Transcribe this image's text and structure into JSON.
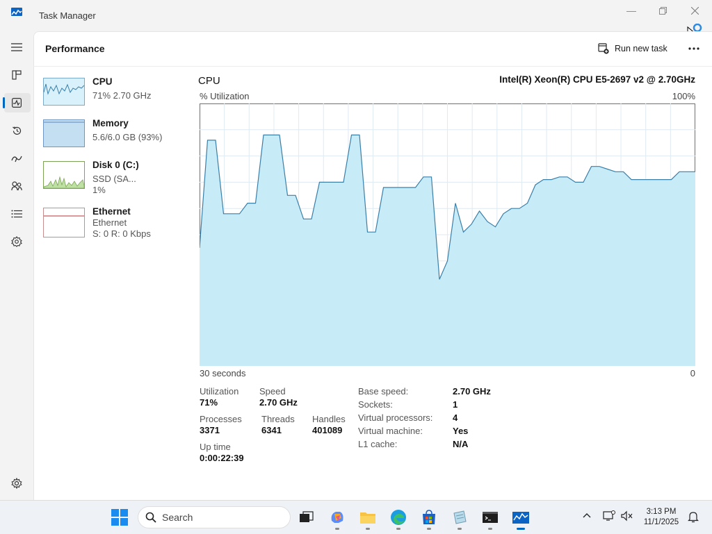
{
  "window": {
    "title": "Task Manager"
  },
  "header": {
    "page_title": "Performance",
    "run_new_task": "Run new task"
  },
  "devices": [
    {
      "name": "CPU",
      "detail1": "71%  2.70 GHz",
      "detail2": ""
    },
    {
      "name": "Memory",
      "detail1": "5.6/6.0 GB (93%)",
      "detail2": ""
    },
    {
      "name": "Disk 0 (C:)",
      "detail1": "SSD (SA...",
      "detail2": "1%"
    },
    {
      "name": "Ethernet",
      "detail1": "Ethernet",
      "detail2": "S: 0  R: 0 Kbps"
    }
  ],
  "graph": {
    "title": "CPU",
    "model": "Intel(R) Xeon(R) CPU E5-2697 v2 @ 2.70GHz",
    "util_label": "% Utilization",
    "max_label": "100%",
    "time_label": "30 seconds",
    "min_label": "0",
    "fill_color": "#c8ebf8",
    "line_color": "#3a7fa8"
  },
  "chart_data": {
    "type": "area",
    "xlabel": "30 seconds",
    "ylabel": "% Utilization",
    "ylim": [
      0,
      100
    ],
    "values": [
      45,
      86,
      86,
      58,
      58,
      58,
      62,
      62,
      88,
      88,
      88,
      65,
      65,
      56,
      56,
      70,
      70,
      70,
      70,
      88,
      88,
      51,
      51,
      68,
      68,
      68,
      68,
      68,
      72,
      72,
      33,
      40,
      62,
      51,
      54,
      59,
      55,
      53,
      58,
      60,
      60,
      62,
      69,
      71,
      71,
      72,
      72,
      70,
      70,
      76,
      76,
      75,
      74,
      74,
      71,
      71,
      71,
      71,
      71,
      71,
      74,
      74,
      74
    ]
  },
  "stats": {
    "utilization": {
      "label": "Utilization",
      "value": "71%"
    },
    "speed": {
      "label": "Speed",
      "value": "2.70 GHz"
    },
    "processes": {
      "label": "Processes",
      "value": "3371"
    },
    "threads": {
      "label": "Threads",
      "value": "6341"
    },
    "handles": {
      "label": "Handles",
      "value": "401089"
    },
    "uptime": {
      "label": "Up time",
      "value": "0:00:22:39"
    },
    "base_speed": {
      "label": "Base speed:",
      "value": "2.70 GHz"
    },
    "sockets": {
      "label": "Sockets:",
      "value": "1"
    },
    "virtual_processors": {
      "label": "Virtual processors:",
      "value": "4"
    },
    "virtual_machine": {
      "label": "Virtual machine:",
      "value": "Yes"
    },
    "l1_cache": {
      "label": "L1 cache:",
      "value": "N/A"
    }
  },
  "taskbar": {
    "search_label": "Search",
    "time": "3:13 PM",
    "date": "11/1/2025"
  },
  "icons": {
    "nav": [
      "hamburger-icon",
      "processes-icon",
      "performance-icon",
      "app-history-icon",
      "startup-icon",
      "users-icon",
      "details-icon",
      "services-icon",
      "settings-icon"
    ]
  }
}
